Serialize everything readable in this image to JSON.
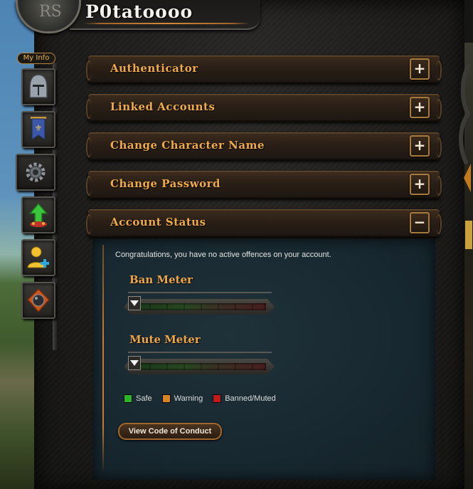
{
  "header": {
    "player_name": "P0tatoooo",
    "crest_glyph": "RS"
  },
  "nav": {
    "my_info_label": "My Info",
    "items": [
      {
        "icon": "helmet-icon"
      },
      {
        "icon": "banner-icon"
      },
      {
        "icon": "gear-icon"
      },
      {
        "icon": "upgrade-arrow-icon"
      },
      {
        "icon": "add-friend-icon"
      },
      {
        "icon": "bomb-icon"
      }
    ]
  },
  "sections": [
    {
      "label": "Authenticator",
      "toggle": "+"
    },
    {
      "label": "Linked Accounts",
      "toggle": "+"
    },
    {
      "label": "Change Character Name",
      "toggle": "+"
    },
    {
      "label": "Change Password",
      "toggle": "+"
    },
    {
      "label": "Account Status",
      "toggle": "−"
    }
  ],
  "account_status": {
    "message": "Congratulations, you have no active offences on your account.",
    "ban_meter": {
      "title": "Ban Meter",
      "level": 0
    },
    "mute_meter": {
      "title": "Mute Meter",
      "level": 0
    },
    "legend": [
      {
        "label": "Safe",
        "color": "#2db52a"
      },
      {
        "label": "Warning",
        "color": "#d9841f"
      },
      {
        "label": "Banned/Muted",
        "color": "#c01a1a"
      }
    ],
    "code_of_conduct_label": "View Code of Conduct"
  },
  "colors": {
    "accent_gold": "#efaa4b",
    "panel_bg": "#182830"
  }
}
